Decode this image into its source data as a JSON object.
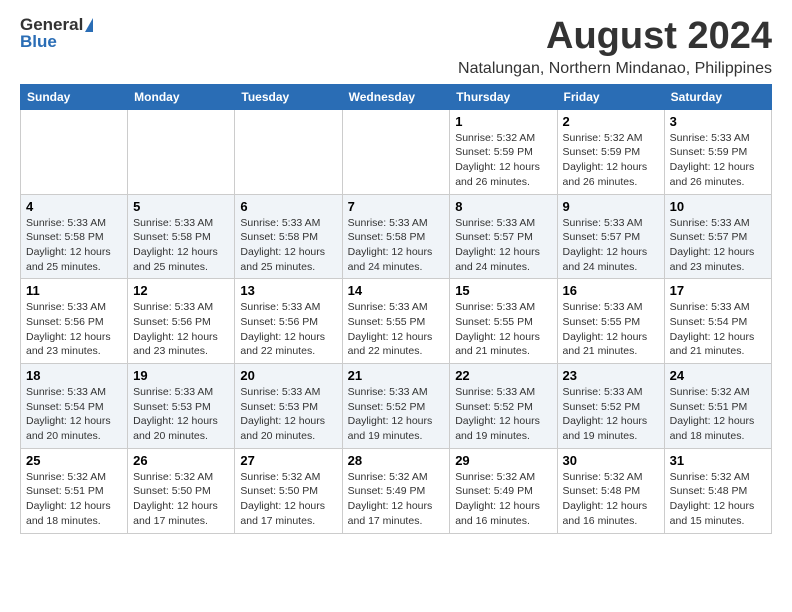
{
  "header": {
    "logo_general": "General",
    "logo_blue": "Blue",
    "month_title": "August 2024",
    "location": "Natalungan, Northern Mindanao, Philippines"
  },
  "days_of_week": [
    "Sunday",
    "Monday",
    "Tuesday",
    "Wednesday",
    "Thursday",
    "Friday",
    "Saturday"
  ],
  "weeks": [
    [
      {
        "day": "",
        "info": ""
      },
      {
        "day": "",
        "info": ""
      },
      {
        "day": "",
        "info": ""
      },
      {
        "day": "",
        "info": ""
      },
      {
        "day": "1",
        "info": "Sunrise: 5:32 AM\nSunset: 5:59 PM\nDaylight: 12 hours\nand 26 minutes."
      },
      {
        "day": "2",
        "info": "Sunrise: 5:32 AM\nSunset: 5:59 PM\nDaylight: 12 hours\nand 26 minutes."
      },
      {
        "day": "3",
        "info": "Sunrise: 5:33 AM\nSunset: 5:59 PM\nDaylight: 12 hours\nand 26 minutes."
      }
    ],
    [
      {
        "day": "4",
        "info": "Sunrise: 5:33 AM\nSunset: 5:58 PM\nDaylight: 12 hours\nand 25 minutes."
      },
      {
        "day": "5",
        "info": "Sunrise: 5:33 AM\nSunset: 5:58 PM\nDaylight: 12 hours\nand 25 minutes."
      },
      {
        "day": "6",
        "info": "Sunrise: 5:33 AM\nSunset: 5:58 PM\nDaylight: 12 hours\nand 25 minutes."
      },
      {
        "day": "7",
        "info": "Sunrise: 5:33 AM\nSunset: 5:58 PM\nDaylight: 12 hours\nand 24 minutes."
      },
      {
        "day": "8",
        "info": "Sunrise: 5:33 AM\nSunset: 5:57 PM\nDaylight: 12 hours\nand 24 minutes."
      },
      {
        "day": "9",
        "info": "Sunrise: 5:33 AM\nSunset: 5:57 PM\nDaylight: 12 hours\nand 24 minutes."
      },
      {
        "day": "10",
        "info": "Sunrise: 5:33 AM\nSunset: 5:57 PM\nDaylight: 12 hours\nand 23 minutes."
      }
    ],
    [
      {
        "day": "11",
        "info": "Sunrise: 5:33 AM\nSunset: 5:56 PM\nDaylight: 12 hours\nand 23 minutes."
      },
      {
        "day": "12",
        "info": "Sunrise: 5:33 AM\nSunset: 5:56 PM\nDaylight: 12 hours\nand 23 minutes."
      },
      {
        "day": "13",
        "info": "Sunrise: 5:33 AM\nSunset: 5:56 PM\nDaylight: 12 hours\nand 22 minutes."
      },
      {
        "day": "14",
        "info": "Sunrise: 5:33 AM\nSunset: 5:55 PM\nDaylight: 12 hours\nand 22 minutes."
      },
      {
        "day": "15",
        "info": "Sunrise: 5:33 AM\nSunset: 5:55 PM\nDaylight: 12 hours\nand 21 minutes."
      },
      {
        "day": "16",
        "info": "Sunrise: 5:33 AM\nSunset: 5:55 PM\nDaylight: 12 hours\nand 21 minutes."
      },
      {
        "day": "17",
        "info": "Sunrise: 5:33 AM\nSunset: 5:54 PM\nDaylight: 12 hours\nand 21 minutes."
      }
    ],
    [
      {
        "day": "18",
        "info": "Sunrise: 5:33 AM\nSunset: 5:54 PM\nDaylight: 12 hours\nand 20 minutes."
      },
      {
        "day": "19",
        "info": "Sunrise: 5:33 AM\nSunset: 5:53 PM\nDaylight: 12 hours\nand 20 minutes."
      },
      {
        "day": "20",
        "info": "Sunrise: 5:33 AM\nSunset: 5:53 PM\nDaylight: 12 hours\nand 20 minutes."
      },
      {
        "day": "21",
        "info": "Sunrise: 5:33 AM\nSunset: 5:52 PM\nDaylight: 12 hours\nand 19 minutes."
      },
      {
        "day": "22",
        "info": "Sunrise: 5:33 AM\nSunset: 5:52 PM\nDaylight: 12 hours\nand 19 minutes."
      },
      {
        "day": "23",
        "info": "Sunrise: 5:33 AM\nSunset: 5:52 PM\nDaylight: 12 hours\nand 19 minutes."
      },
      {
        "day": "24",
        "info": "Sunrise: 5:32 AM\nSunset: 5:51 PM\nDaylight: 12 hours\nand 18 minutes."
      }
    ],
    [
      {
        "day": "25",
        "info": "Sunrise: 5:32 AM\nSunset: 5:51 PM\nDaylight: 12 hours\nand 18 minutes."
      },
      {
        "day": "26",
        "info": "Sunrise: 5:32 AM\nSunset: 5:50 PM\nDaylight: 12 hours\nand 17 minutes."
      },
      {
        "day": "27",
        "info": "Sunrise: 5:32 AM\nSunset: 5:50 PM\nDaylight: 12 hours\nand 17 minutes."
      },
      {
        "day": "28",
        "info": "Sunrise: 5:32 AM\nSunset: 5:49 PM\nDaylight: 12 hours\nand 17 minutes."
      },
      {
        "day": "29",
        "info": "Sunrise: 5:32 AM\nSunset: 5:49 PM\nDaylight: 12 hours\nand 16 minutes."
      },
      {
        "day": "30",
        "info": "Sunrise: 5:32 AM\nSunset: 5:48 PM\nDaylight: 12 hours\nand 16 minutes."
      },
      {
        "day": "31",
        "info": "Sunrise: 5:32 AM\nSunset: 5:48 PM\nDaylight: 12 hours\nand 15 minutes."
      }
    ]
  ]
}
